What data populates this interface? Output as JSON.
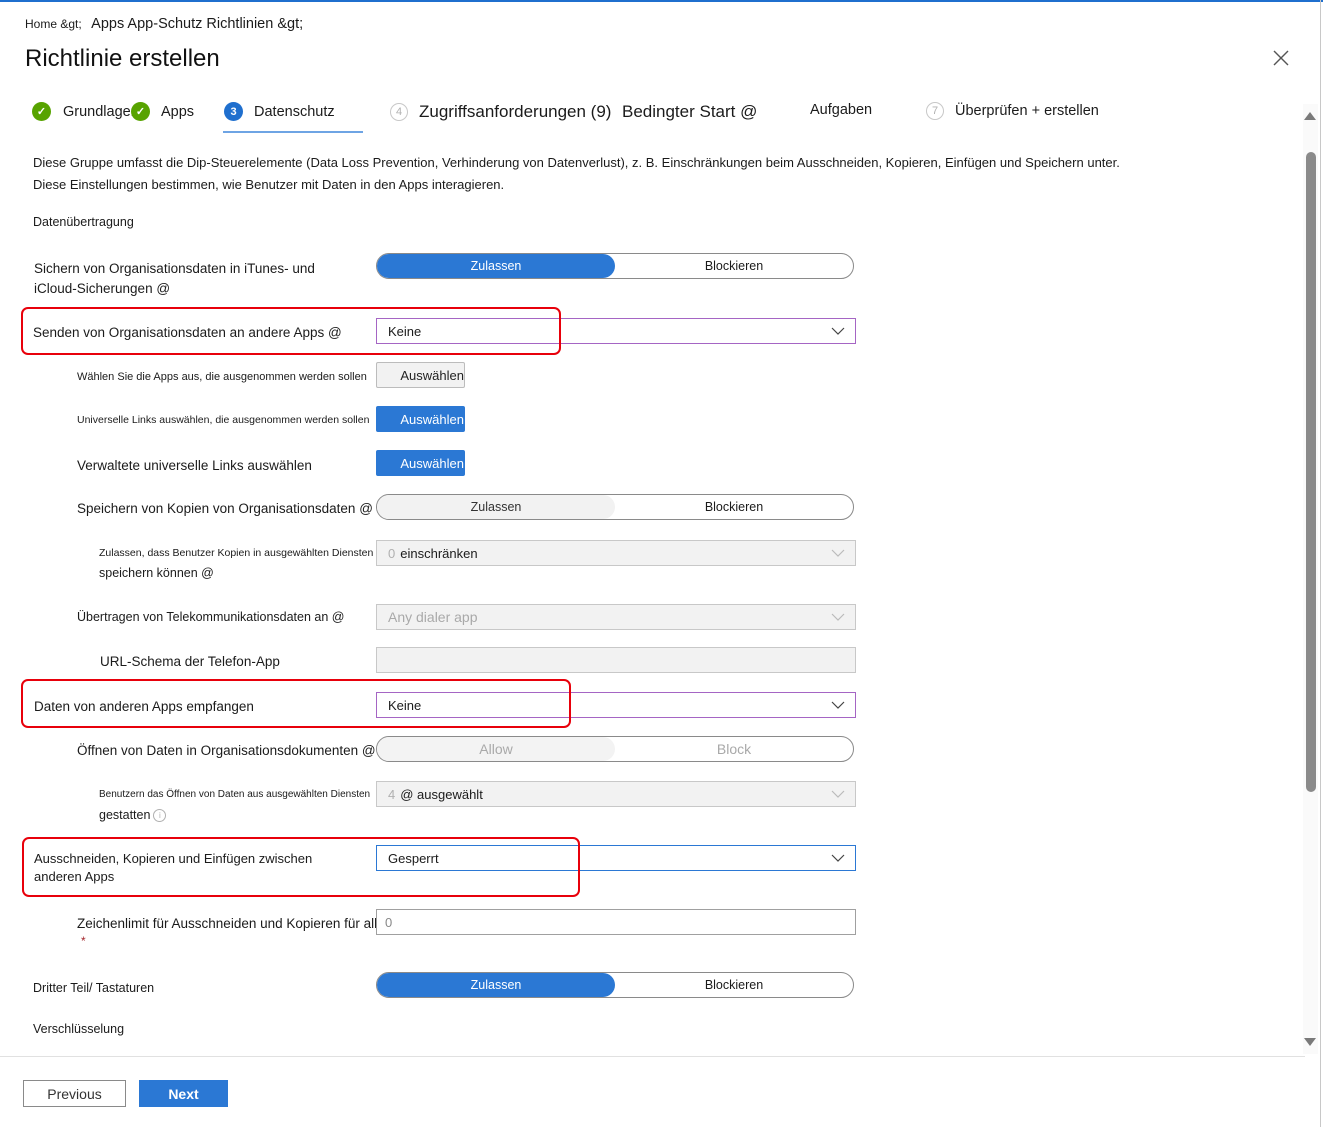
{
  "breadcrumb": {
    "home": "Home &gt;",
    "path": "Apps App-Schutz Richtlinien &gt;"
  },
  "page_title": "Richtlinie erstellen",
  "close_icon": "close-icon",
  "steps": [
    {
      "number": "✓",
      "label": "Grundlagen",
      "state": "done"
    },
    {
      "number": "✓",
      "label": "Apps",
      "state": "done"
    },
    {
      "number": "3",
      "label": "Datenschutz",
      "state": "active"
    },
    {
      "number": "4",
      "label": "Zugriffsanforderungen (9)",
      "state": "todo"
    },
    {
      "number": "",
      "label": "Bedingter Start @",
      "state": "todo"
    },
    {
      "number": "",
      "label": "Aufgaben",
      "state": "todo"
    },
    {
      "number": "7",
      "label": "Überprüfen + erstellen",
      "state": "todo"
    }
  ],
  "description": {
    "line1": "Diese Gruppe umfasst die Dip-Steuerelemente (Data Loss Prevention, Verhinderung von Datenverlust), z. B. Einschränkungen beim Ausschneiden, Kopieren, Einfügen und Speichern unter.",
    "line2": "Diese Einstellungen bestimmen, wie Benutzer mit Daten in den Apps interagieren."
  },
  "sections": {
    "data_transfer": "Datenübertragung",
    "encryption": "Verschlüsselung"
  },
  "settings": {
    "backup": {
      "label1": "Sichern von Organisationsdaten in iTunes- und",
      "label2": "iCloud-Sicherungen @",
      "options": [
        "Zulassen",
        "Blockieren"
      ],
      "selected": "Zulassen"
    },
    "send_data": {
      "label": "Senden von Organisationsdaten an andere Apps @",
      "value": "Keine"
    },
    "exempt_apps": {
      "label": "Wählen Sie die Apps aus, die ausgenommen werden sollen",
      "button": "Auswählen"
    },
    "universal_links": {
      "label": "Universelle Links auswählen, die ausgenommen werden sollen",
      "button": "Auswählen"
    },
    "managed_links": {
      "label": "Verwaltete universelle Links auswählen",
      "button": "Auswählen"
    },
    "save_copies": {
      "label": "Speichern von Kopien von Organisationsdaten @",
      "options": [
        "Zulassen",
        "Blockieren"
      ],
      "selected": "Zulassen"
    },
    "save_services": {
      "label1": "Zulassen, dass Benutzer Kopien in ausgewählten Diensten",
      "label2": "speichern können @",
      "count": "0",
      "value": "einschränken"
    },
    "telecom": {
      "label": "Übertragen von Telekommunikationsdaten an @",
      "value": "Any dialer app"
    },
    "dialer_url": {
      "label": "URL-Schema der Telefon-App",
      "value": ""
    },
    "receive_data": {
      "label": "Daten von anderen Apps empfangen",
      "value": "Keine"
    },
    "open_data": {
      "label": "Öffnen von Daten in Organisationsdokumenten @",
      "options": [
        "Allow",
        "Block"
      ],
      "selected": "Allow"
    },
    "open_services": {
      "label1": "Benutzern das Öffnen von Daten aus ausgewählten Diensten",
      "label2": "gestatten",
      "count": "4",
      "value": "@ ausgewählt"
    },
    "cut_copy": {
      "label1": "Ausschneiden, Kopieren und Einfügen zwischen",
      "label2": "anderen Apps",
      "value": "Gesperrt"
    },
    "char_limit": {
      "label": "Zeichenlimit für Ausschneiden und Kopieren für alle Apps",
      "value": "0",
      "required_mark": "*"
    },
    "keyboards": {
      "label": "Dritter Teil/ Tastaturen",
      "options": [
        "Zulassen",
        "Blockieren"
      ],
      "selected": "Zulassen"
    }
  },
  "footer": {
    "previous": "Previous",
    "next": "Next"
  },
  "colors": {
    "accent": "#2b78d4",
    "success": "#57a300",
    "highlight": "#e8000b"
  }
}
